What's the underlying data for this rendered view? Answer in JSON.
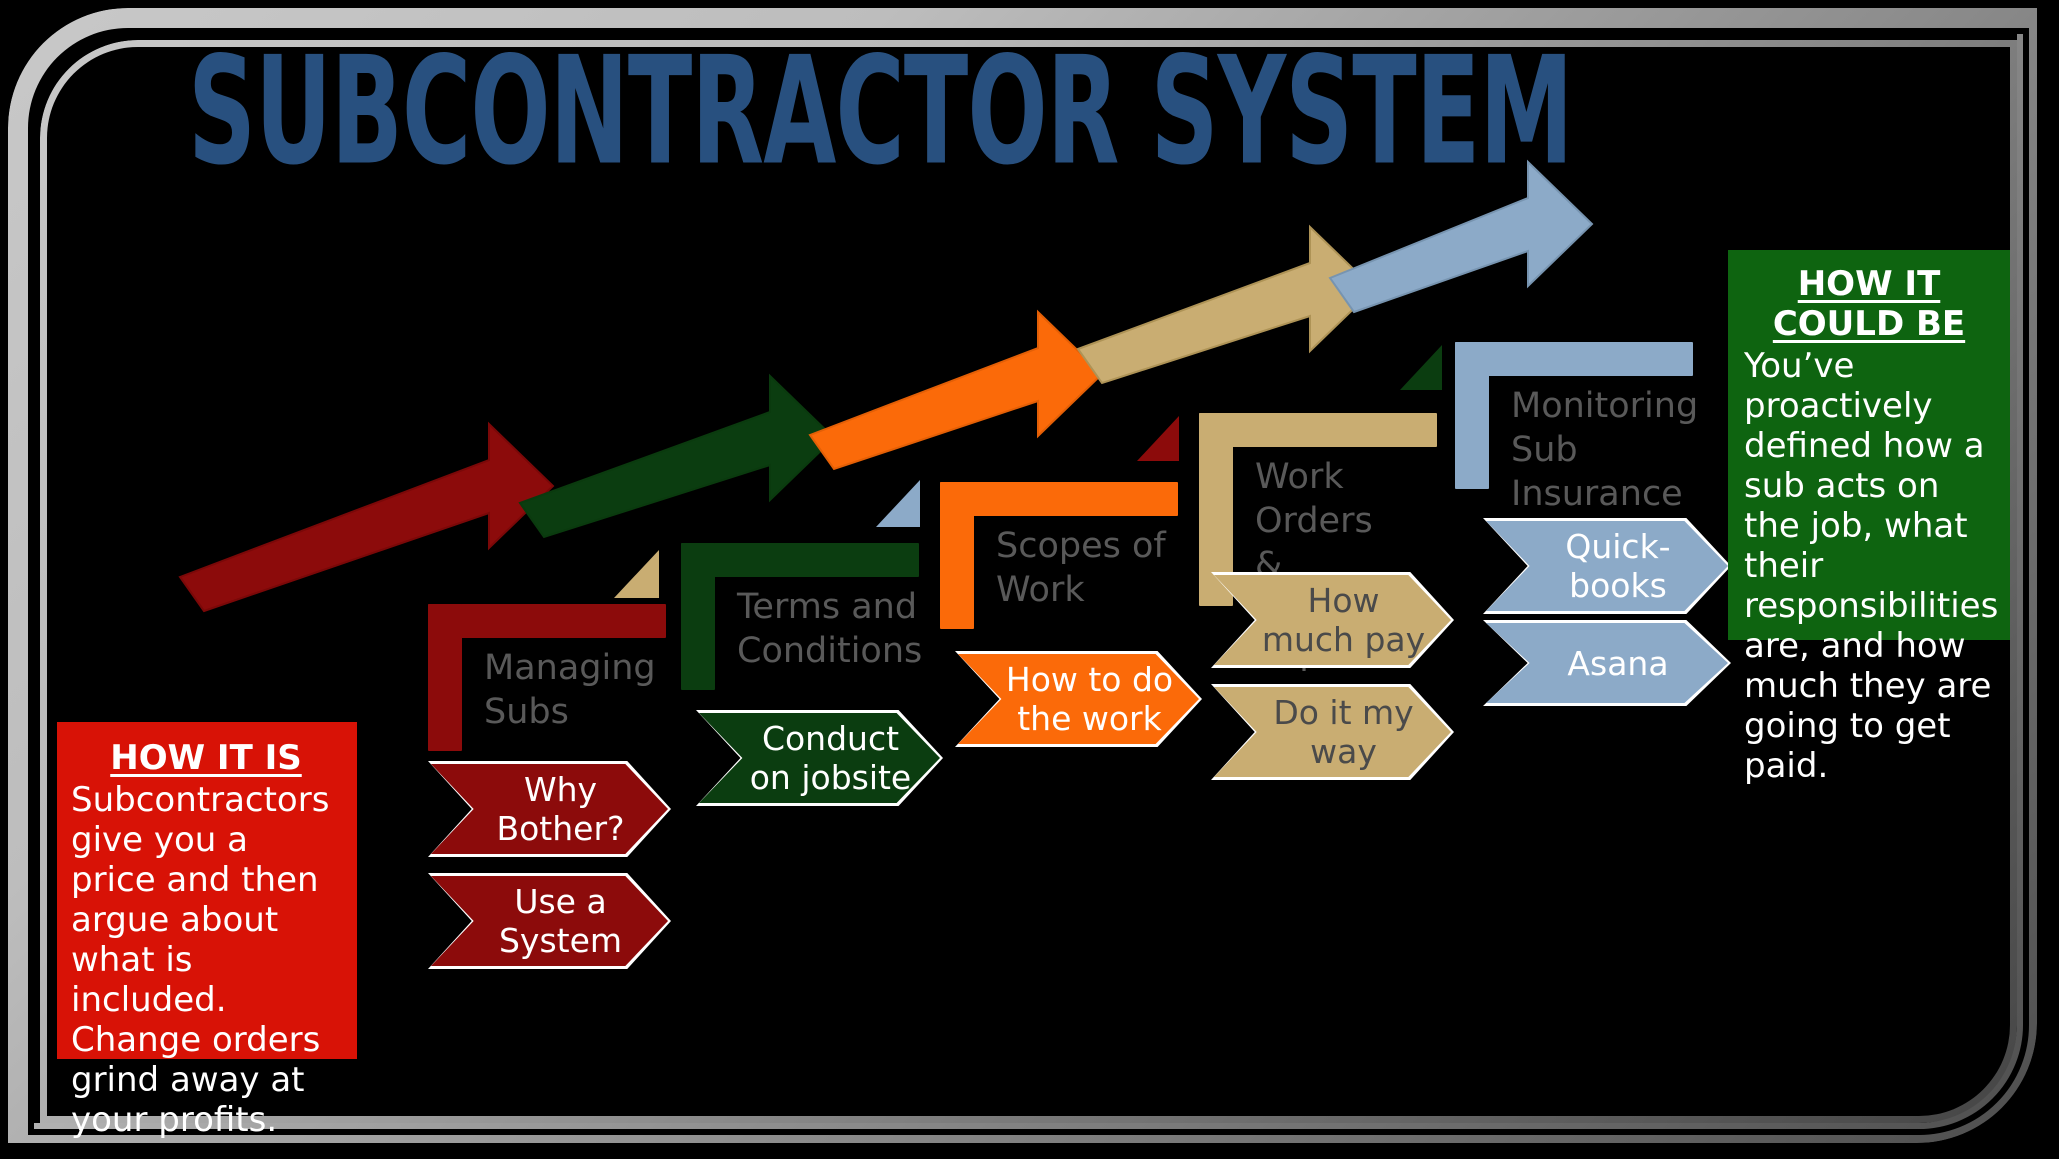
{
  "title": "SUBCONTRACTOR SYSTEM",
  "colors": {
    "title_blue": "#28507F",
    "dark_red": "#8C0B0B",
    "bright_red": "#D81206",
    "dark_green": "#0B3D10",
    "green": "#0E6410",
    "orange": "#FB6A09",
    "tan": "#C9AD72",
    "blue": "#8CAAC8",
    "label_gray": "#595959",
    "frame_gray": "#BDBDBD",
    "background": "#000000"
  },
  "side_boxes": {
    "left": {
      "heading": "HOW IT IS",
      "body": "Subcontractors give you a price and then argue about what is included. Change orders grind away at your profits.",
      "color": "#D81206"
    },
    "right": {
      "heading": "HOW IT COULD BE",
      "body": "You’ve proactively defined how a sub acts on the job, what their responsibilities are, and how much they are going to get paid.",
      "color": "#0E6410"
    }
  },
  "stages": [
    {
      "index": 1,
      "bracket_label": "Managing\nSubs",
      "color": "#8C0B0B",
      "text_color": "#ffffff",
      "chevrons": [
        "Why\nBother?",
        "Use a\nSystem"
      ]
    },
    {
      "index": 2,
      "bracket_label": "Terms and\nConditions",
      "color": "#0B3D10",
      "text_color": "#ffffff",
      "chevrons": [
        "Conduct\non jobsite"
      ]
    },
    {
      "index": 3,
      "bracket_label": "Scopes of\nWork",
      "color": "#FB6A09",
      "text_color": "#ffffff",
      "chevrons": [
        "How to do\nthe work"
      ]
    },
    {
      "index": 4,
      "bracket_label": "Work Orders\n& Inspection\nReports",
      "color": "#C9AD72",
      "text_color": "#4A4A4A",
      "chevrons": [
        "How\nmuch pay",
        "Do it my\nway"
      ]
    },
    {
      "index": 5,
      "bracket_label": "Monitoring\nSub Insurance",
      "color": "#8CAAC8",
      "text_color": "#ffffff",
      "chevrons": [
        "Quick-\nbooks",
        "Asana"
      ]
    }
  ],
  "arrows": [
    {
      "name": "arrow-stage-1",
      "color": "#8C0B0B"
    },
    {
      "name": "arrow-stage-2",
      "color": "#0B3D10"
    },
    {
      "name": "arrow-stage-3",
      "color": "#FB6A09"
    },
    {
      "name": "arrow-stage-4",
      "color": "#C9AD72"
    },
    {
      "name": "arrow-stage-5",
      "color": "#8CAAC8"
    }
  ],
  "triangles": [
    {
      "name": "triangle-tan-1",
      "color": "#C9AD72"
    },
    {
      "name": "triangle-blue-1",
      "color": "#8CAAC8"
    },
    {
      "name": "triangle-blue-2",
      "color": "#8CAAC8"
    },
    {
      "name": "triangle-darkred-1",
      "color": "#8C0B0B"
    },
    {
      "name": "triangle-green-1",
      "color": "#0B3D10"
    }
  ]
}
